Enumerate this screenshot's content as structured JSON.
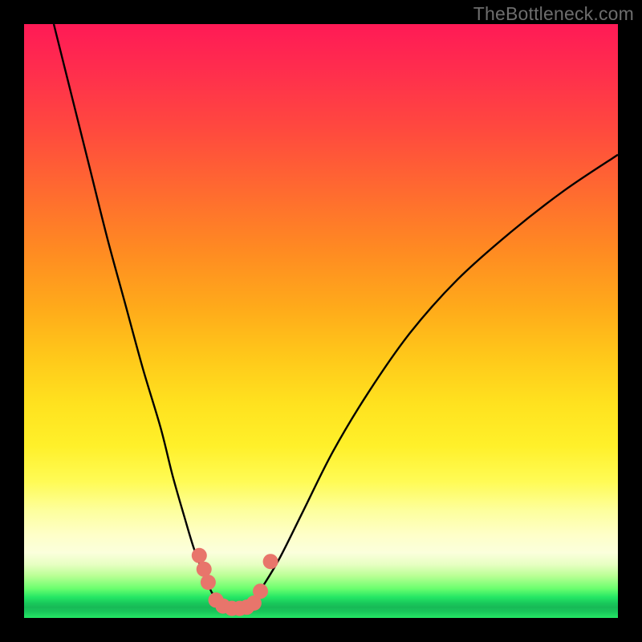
{
  "watermark": "TheBottleneck.com",
  "colors": {
    "frame": "#000000",
    "curve": "#000000",
    "markers": "#e8756b",
    "gradient_top": "#ff1a56",
    "gradient_mid": "#ffe21f",
    "gradient_band": "#feffc8",
    "gradient_green": "#19c95b"
  },
  "chart_data": {
    "type": "line",
    "title": "",
    "xlabel": "",
    "ylabel": "",
    "xlim": [
      0,
      100
    ],
    "ylim": [
      0,
      100
    ],
    "grid": false,
    "legend": false,
    "annotations": [],
    "series": [
      {
        "name": "left-branch",
        "x": [
          5,
          8,
          11,
          14,
          17,
          20,
          23,
          25,
          27,
          28.5,
          30,
          31.5,
          33
        ],
        "y": [
          100,
          88,
          76,
          64,
          53,
          42,
          32,
          24,
          17,
          12,
          8,
          4.5,
          2
        ]
      },
      {
        "name": "right-branch",
        "x": [
          38,
          40,
          43,
          47,
          52,
          58,
          65,
          73,
          82,
          91,
          100
        ],
        "y": [
          2,
          5,
          10,
          18,
          28,
          38,
          48,
          57,
          65,
          72,
          78
        ]
      },
      {
        "name": "valley-floor",
        "x": [
          33,
          34.5,
          36,
          37.5,
          38
        ],
        "y": [
          2,
          1.5,
          1.5,
          1.7,
          2
        ]
      }
    ],
    "markers": {
      "name": "highlighted-points",
      "points": [
        {
          "x": 29.5,
          "y": 10.5
        },
        {
          "x": 30.3,
          "y": 8.2
        },
        {
          "x": 31.0,
          "y": 6.0
        },
        {
          "x": 32.3,
          "y": 3.0
        },
        {
          "x": 33.5,
          "y": 2.0
        },
        {
          "x": 35.0,
          "y": 1.6
        },
        {
          "x": 36.3,
          "y": 1.6
        },
        {
          "x": 37.5,
          "y": 1.8
        },
        {
          "x": 38.7,
          "y": 2.5
        },
        {
          "x": 39.8,
          "y": 4.5
        },
        {
          "x": 41.5,
          "y": 9.5
        }
      ]
    }
  }
}
